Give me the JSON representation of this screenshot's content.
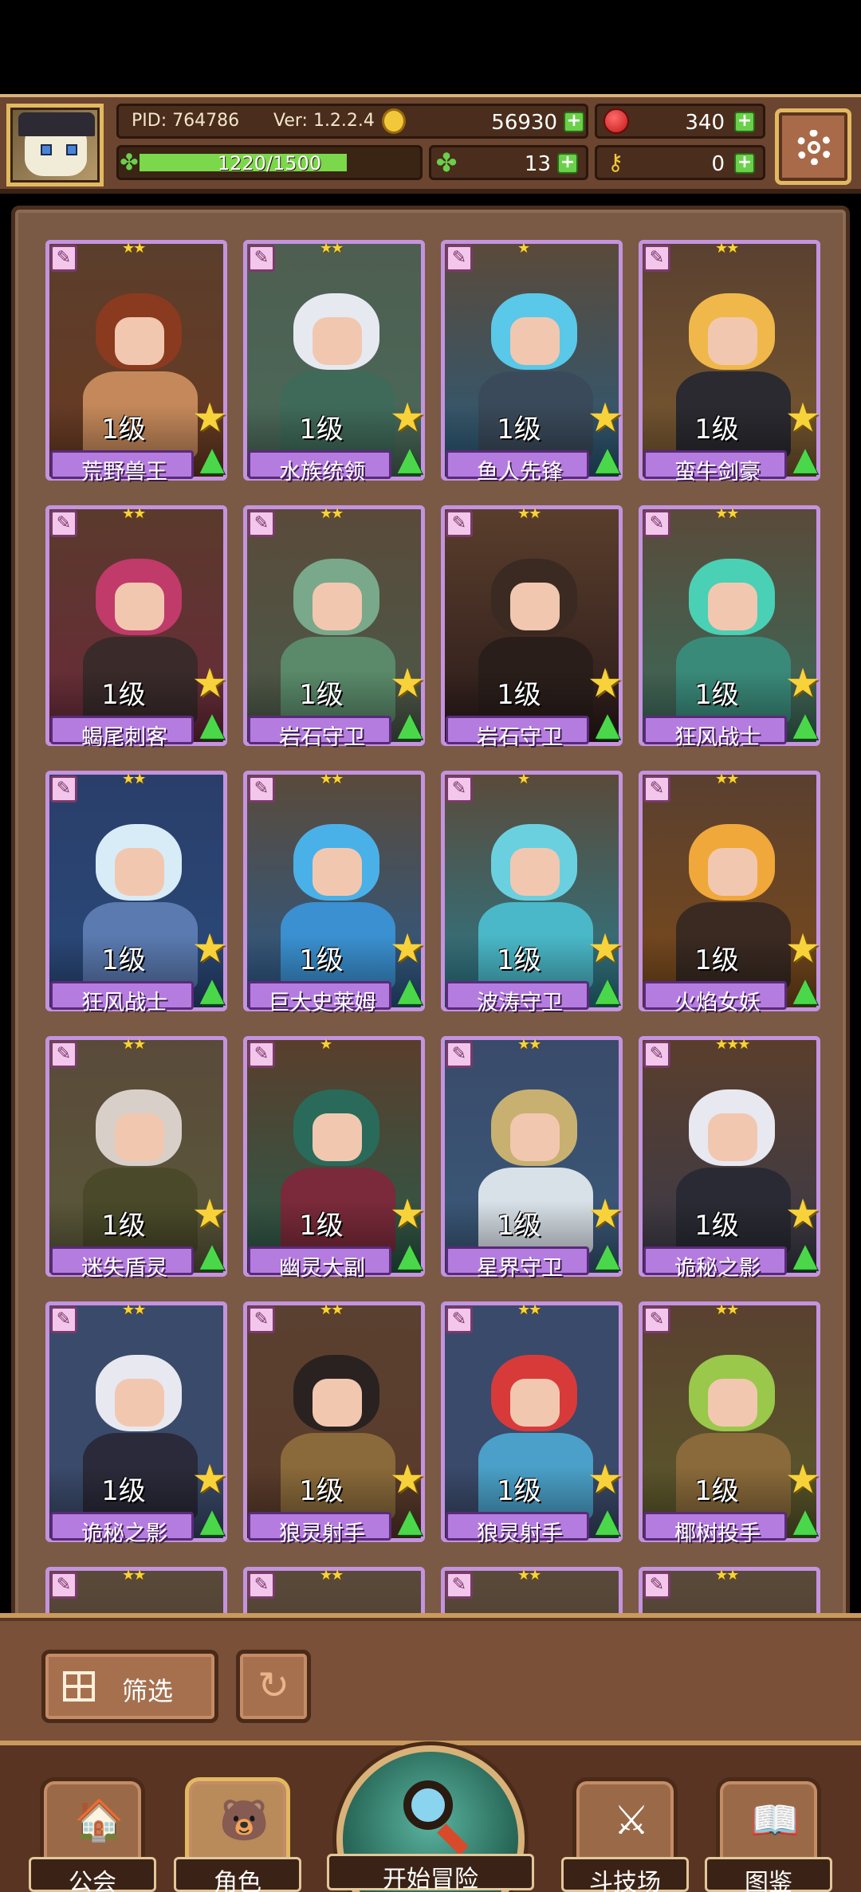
{
  "hud": {
    "pid": "PID: 764786",
    "version": "Ver: 1.2.2.4",
    "gold": "56930",
    "gems": "340",
    "xp_text": "1220/1500",
    "xp_progress": 0.8133,
    "clover": "13",
    "keys": "0"
  },
  "cards": [
    {
      "name": "荒野兽王",
      "level": "1级",
      "stars": "★★",
      "theme": "#6a3a22",
      "hair": "#8a3a1e",
      "body_color": "#c4885a",
      "bg": "#5a3e2c"
    },
    {
      "name": "水族统领",
      "level": "1级",
      "stars": "★★",
      "theme": "#4a6a5a",
      "hair": "#e6eaf0",
      "body_color": "#3f6a5a",
      "bg": "#4e5e50"
    },
    {
      "name": "鱼人先锋",
      "level": "1级",
      "stars": "★",
      "theme": "#2a5a7a",
      "hair": "#5ac8e8",
      "body_color": "#3a4a5a",
      "bg": "#5a4a3a"
    },
    {
      "name": "蛮牛剑豪",
      "level": "1级",
      "stars": "★★",
      "theme": "#7a5a30",
      "hair": "#f0b84a",
      "body_color": "#2a2a30",
      "bg": "#5a4030"
    },
    {
      "name": "蝎尾刺客",
      "level": "1级",
      "stars": "★★",
      "theme": "#6a2a3a",
      "hair": "#c03a6a",
      "body_color": "#3a2a2a",
      "bg": "#5a3a2c"
    },
    {
      "name": "岩石守卫",
      "level": "1级",
      "stars": "★★",
      "theme": "#4a5a4a",
      "hair": "#7aa88a",
      "body_color": "#5a8a6a",
      "bg": "#5a4a3a"
    },
    {
      "name": "岩石守卫",
      "level": "1级",
      "stars": "★★",
      "theme": "#2a1a1a",
      "hair": "#3a2a22",
      "body_color": "#2a1e1a",
      "bg": "#5a3e2c"
    },
    {
      "name": "狂风战士",
      "level": "1级",
      "stars": "★★",
      "theme": "#3a6a5a",
      "hair": "#4ad0b4",
      "body_color": "#3a8a7a",
      "bg": "#5a4a3a"
    },
    {
      "name": "狂风战士",
      "level": "1级",
      "stars": "★★",
      "theme": "#2a4a7a",
      "hair": "#d8ecf8",
      "body_color": "#5a7ab0",
      "bg": "#2a3e6a"
    },
    {
      "name": "巨大史莱姆",
      "level": "1级",
      "stars": "★★",
      "theme": "#2a5a8a",
      "hair": "#4ab0e8",
      "body_color": "#3a90d0",
      "bg": "#5a4a3a"
    },
    {
      "name": "波涛守卫",
      "level": "1级",
      "stars": "★",
      "theme": "#2a7a8a",
      "hair": "#6ad0e0",
      "body_color": "#4ab8c8",
      "bg": "#5a4a3a"
    },
    {
      "name": "火焰女妖",
      "level": "1级",
      "stars": "★★",
      "theme": "#7a4a1a",
      "hair": "#f0a83a",
      "body_color": "#3a2a22",
      "bg": "#5a4030"
    },
    {
      "name": "迷失盾灵",
      "level": "1级",
      "stars": "★★",
      "theme": "#5a5a3a",
      "hair": "#d8d0c8",
      "body_color": "#4a4a2a",
      "bg": "#5a4a3a"
    },
    {
      "name": "幽灵大副",
      "level": "1级",
      "stars": "★",
      "theme": "#2a5a4a",
      "hair": "#2a6a5a",
      "body_color": "#7a2a3a",
      "bg": "#5a3e2c"
    },
    {
      "name": "星界守卫",
      "level": "1级",
      "stars": "★★",
      "theme": "#3a5a7a",
      "hair": "#c8b070",
      "body_color": "#d8e0e8",
      "bg": "#3a4a6a"
    },
    {
      "name": "诡秘之影",
      "level": "1级",
      "stars": "★★★",
      "theme": "#3a3a4a",
      "hair": "#e8e8f0",
      "body_color": "#2a2a34",
      "bg": "#5a3e2c"
    },
    {
      "name": "诡秘之影",
      "level": "1级",
      "stars": "★★",
      "theme": "#3a4a6a",
      "hair": "#e8e8f0",
      "body_color": "#2a2a3a",
      "bg": "#3a4a6a"
    },
    {
      "name": "狼灵射手",
      "level": "1级",
      "stars": "★★",
      "theme": "#5a3a2a",
      "hair": "#2a2220",
      "body_color": "#8a6a3a",
      "bg": "#5a4030"
    },
    {
      "name": "狼灵射手",
      "level": "1级",
      "stars": "★★",
      "theme": "#3a4a6a",
      "hair": "#d83a3a",
      "body_color": "#4aa0c8",
      "bg": "#3a4a6a"
    },
    {
      "name": "椰树投手",
      "level": "1级",
      "stars": "★★",
      "theme": "#5a5a2a",
      "hair": "#9ac84a",
      "body_color": "#8a6a3a",
      "bg": "#5a4030"
    }
  ],
  "filter": {
    "label": "筛选"
  },
  "nav": {
    "guild": "公会",
    "character": "角色",
    "adventure": "开始冒险",
    "arena": "斗技场",
    "codex": "图鉴"
  }
}
